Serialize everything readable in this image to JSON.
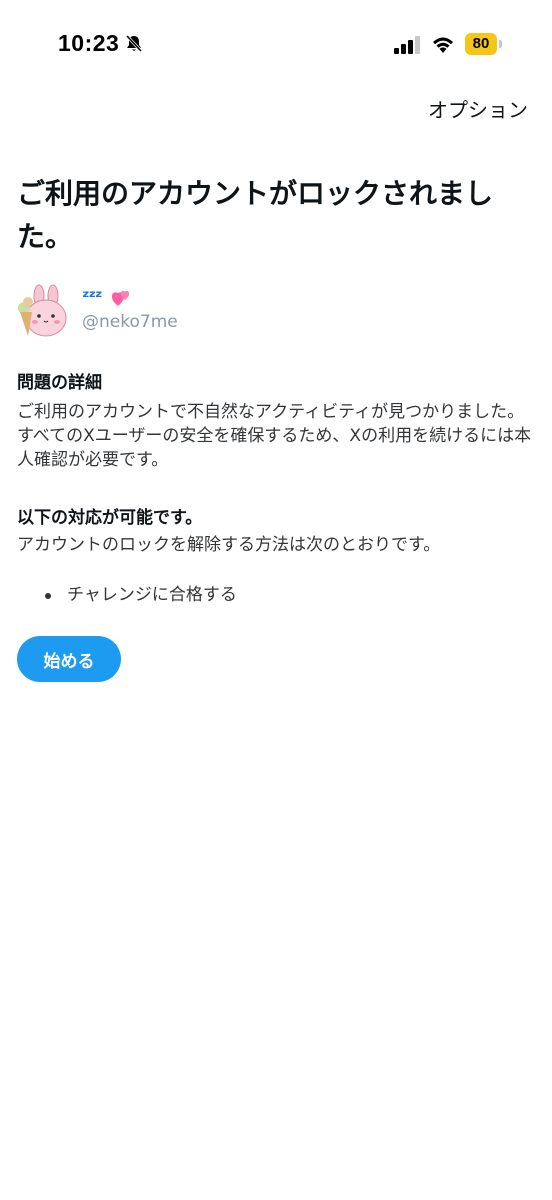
{
  "status_bar": {
    "time": "10:23",
    "battery_level": "80",
    "battery_color": "#f5c518",
    "icons": [
      "bell-muted-icon",
      "signal-icon",
      "wifi-icon",
      "battery-icon"
    ]
  },
  "header": {
    "options_label": "オプション"
  },
  "title": "ご利用のアカウントがロックされました。",
  "account": {
    "display_name": "ᶻᶻᶻ",
    "handle": "@neko7me",
    "icons": [
      "avatar-rabbit-icon",
      "heart-icon"
    ]
  },
  "problem": {
    "heading": "問題の詳細",
    "body": "ご利用のアカウントで不自然なアクティビティが見つかりました。すべてのXユーザーの安全を確保するため、Xの利用を続けるには本人確認が必要です。"
  },
  "actions": {
    "heading": "以下の対応が可能です。",
    "body": "アカウントのロックを解除する方法は次のとおりです。",
    "items": [
      "チャレンジに合格する"
    ]
  },
  "start_button": {
    "label": "始める",
    "color": "#1d9bf0"
  }
}
